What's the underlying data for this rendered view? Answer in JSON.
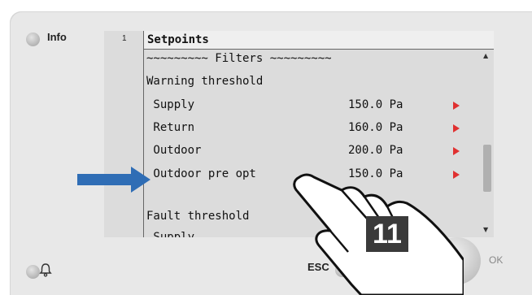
{
  "device": {
    "info_label": "Info",
    "esc_label": "ESC",
    "ok_label": "OK",
    "bell_icon": "bell-icon"
  },
  "screen": {
    "line_number": "1",
    "title": "Setpoints",
    "rows": [
      {
        "label": "~~~~~~~~~ Filters ~~~~~~~~~",
        "value": ""
      },
      {
        "label": "Warning threshold",
        "value": ""
      },
      {
        "label": " Supply",
        "value": "150.0 Pa"
      },
      {
        "label": " Return",
        "value": "160.0 Pa"
      },
      {
        "label": " Outdoor",
        "value": "200.0 Pa"
      },
      {
        "label": " Outdoor pre opt",
        "value": "150.0 Pa"
      },
      {
        "label": "",
        "value": ""
      },
      {
        "label": "Fault threshold",
        "value": ""
      },
      {
        "label": " Supply",
        "value": ""
      }
    ],
    "scroll_fraction": 0.5,
    "row_arrow_color": "#e03030"
  },
  "overlay": {
    "step_number": "11",
    "pointer_arrow_color": "#2f6db5"
  }
}
